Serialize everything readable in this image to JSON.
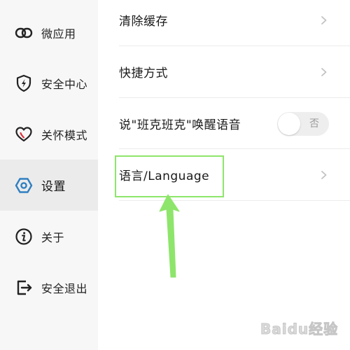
{
  "sidebar": {
    "items": [
      {
        "label": "微应用",
        "icon": "link-chain-icon"
      },
      {
        "label": "安全中心",
        "icon": "shield-bolt-icon"
      },
      {
        "label": "关怀模式",
        "icon": "heart-icon"
      },
      {
        "label": "设置",
        "icon": "hexagon-gear-icon",
        "active": true
      },
      {
        "label": "关于",
        "icon": "info-icon"
      },
      {
        "label": "安全退出",
        "icon": "exit-icon"
      }
    ]
  },
  "settings": {
    "rows": [
      {
        "label": "清除缓存",
        "control": "chevron"
      },
      {
        "label": "快捷方式",
        "control": "chevron"
      },
      {
        "label": "说\"班克班克\"唤醒语音",
        "control": "toggle",
        "toggle_text": "否",
        "toggle_on": false
      },
      {
        "label": "语言/Language",
        "control": "chevron",
        "highlighted": true
      }
    ]
  },
  "annotation": {
    "highlight_color": "#8ee56b",
    "arrow_color": "#8ee56b"
  },
  "watermark": {
    "text": "Baidu经验"
  },
  "colors": {
    "accent": "#2f7fc1",
    "sidebar_bg": "#f7f7f7",
    "sidebar_active_bg": "#ebebeb"
  }
}
